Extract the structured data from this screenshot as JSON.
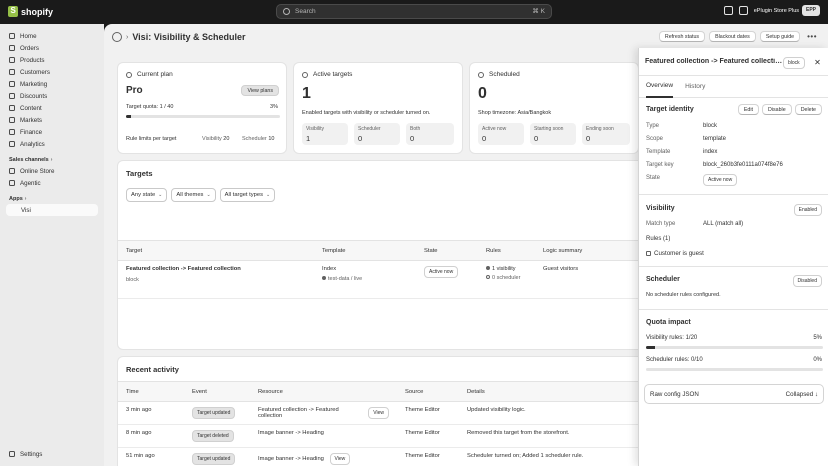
{
  "topbar": {
    "logo_text": "shopify",
    "search_placeholder": "Search",
    "search_shortcut": "⌘ K",
    "store_name": "ePlugin Store Plus",
    "avatar_initials": "EPP"
  },
  "sidebar": {
    "items": [
      {
        "label": "Home"
      },
      {
        "label": "Orders"
      },
      {
        "label": "Products"
      },
      {
        "label": "Customers"
      },
      {
        "label": "Marketing"
      },
      {
        "label": "Discounts"
      },
      {
        "label": "Content"
      },
      {
        "label": "Markets"
      },
      {
        "label": "Finance"
      },
      {
        "label": "Analytics"
      }
    ],
    "sales_channels_label": "Sales channels",
    "channels": [
      {
        "label": "Online Store"
      },
      {
        "label": "Agentic"
      }
    ],
    "apps_label": "Apps",
    "apps": [
      {
        "label": "Visi"
      }
    ],
    "settings_label": "Settings"
  },
  "page": {
    "breadcrumb_sep": "›",
    "title": "Visi: Visibility & Scheduler",
    "refresh_label": "Refresh status",
    "blackout_label": "Blackout dates",
    "setup_label": "Setup guide",
    "more_label": "•••"
  },
  "plan_card": {
    "title": "Current plan",
    "plan": "Pro",
    "view_plans": "View plans",
    "quota_label": "Target quota: 1 / 40",
    "quota_pct": "3%",
    "quota_fraction": 0.03,
    "rule_limits": "Rule limits per target",
    "visibility_label": "Visibility",
    "visibility_limit": "20",
    "scheduler_label": "Scheduler",
    "scheduler_limit": "10"
  },
  "active_card": {
    "title": "Active targets",
    "count": "1",
    "desc": "Enabled targets with visibility or scheduler turned on.",
    "boxes": [
      {
        "label": "Visibility",
        "value": "1"
      },
      {
        "label": "Scheduler",
        "value": "0"
      },
      {
        "label": "Both",
        "value": "0"
      }
    ]
  },
  "scheduled_card": {
    "title": "Scheduled",
    "count": "0",
    "timezone": "Shop timezone: Asia/Bangkok",
    "boxes": [
      {
        "label": "Active now",
        "value": "0"
      },
      {
        "label": "Starting soon",
        "value": "0"
      },
      {
        "label": "Ending soon",
        "value": "0"
      }
    ]
  },
  "targets": {
    "title": "Targets",
    "filter_state": "Any state",
    "filter_themes": "All themes",
    "filter_types": "All target types",
    "columns": [
      "Target",
      "Template",
      "State",
      "Rules",
      "Logic summary"
    ],
    "rows": [
      {
        "target": "Featured collection -> Featured collection",
        "type": "block",
        "template": "Index",
        "theme": "test-data / live",
        "state": "Active now",
        "rule_visibility": "1 visibility",
        "rule_scheduler": "0 scheduler",
        "logic": "Guest visitors"
      }
    ]
  },
  "activity": {
    "title": "Recent activity",
    "columns": [
      "Time",
      "Event",
      "Resource",
      "Source",
      "Details"
    ],
    "rows": [
      {
        "time": "3 min ago",
        "event": "Target updated",
        "resource": "Featured collection -> Featured collection",
        "view": "View",
        "source": "Theme Editor",
        "details": "Updated visibility logic."
      },
      {
        "time": "8 min ago",
        "event": "Target deleted",
        "resource": "Image banner -> Heading",
        "view": "",
        "source": "Theme Editor",
        "details": "Removed this target from the storefront."
      },
      {
        "time": "51 min ago",
        "event": "Target updated",
        "resource": "Image banner -> Heading",
        "view": "View",
        "source": "Theme Editor",
        "details": "Scheduler turned on; Added 1 scheduler rule."
      }
    ]
  },
  "drawer": {
    "title": "Featured collection -> Featured collection",
    "badge": "block",
    "close": "✕",
    "tabs": [
      {
        "label": "Overview"
      },
      {
        "label": "History"
      }
    ],
    "identity": {
      "title": "Target identity",
      "edit": "Edit",
      "disable": "Disable",
      "delete": "Delete",
      "type_label": "Type",
      "type_value": "block",
      "scope_label": "Scope",
      "scope_value": "template",
      "template_label": "Template",
      "template_value": "index",
      "key_label": "Target key",
      "key_value": "block_260b3fe0111a074f8e76",
      "state_label": "State",
      "state_value": "Active now"
    },
    "visibility": {
      "title": "Visibility",
      "status": "Enabled",
      "match_label": "Match type",
      "match_value": "ALL (match all)",
      "rules_label": "Rules (1)",
      "rule_1": "Customer is guest"
    },
    "scheduler": {
      "title": "Scheduler",
      "status": "Disabled",
      "desc": "No scheduler rules configured."
    },
    "quota": {
      "title": "Quota impact",
      "visibility_label": "Visibility rules: 1/20",
      "visibility_pct": "5%",
      "visibility_fraction": 0.05,
      "scheduler_label": "Scheduler rules: 0/10",
      "scheduler_pct": "0%",
      "scheduler_fraction": 0.0
    },
    "raw": {
      "label": "Raw config JSON",
      "state": "Collapsed ↓"
    }
  }
}
